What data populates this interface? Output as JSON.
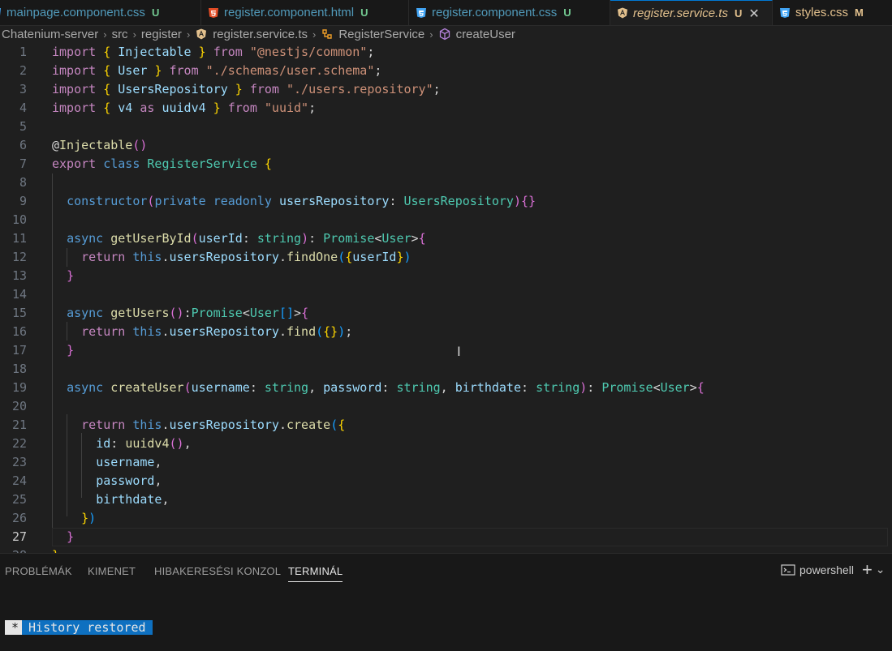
{
  "tabs": [
    {
      "label": "mainpage.component.css",
      "status": "U",
      "icon": "css-icon"
    },
    {
      "label": "register.component.html",
      "status": "U",
      "icon": "html-icon"
    },
    {
      "label": "register.component.css",
      "status": "U",
      "icon": "css-icon"
    },
    {
      "label": "register.service.ts",
      "status": "U",
      "icon": "angular-icon",
      "close": "✕"
    },
    {
      "label": "styles.css",
      "status": "M",
      "icon": "css-icon"
    }
  ],
  "breadcrumb": {
    "items": [
      "Chatenium-server",
      "src",
      "register",
      "register.service.ts",
      "RegisterService",
      "createUser"
    ],
    "separator": "›"
  },
  "editor": {
    "language": "typescript",
    "current_line": 27,
    "lines": [
      [
        [
          "import",
          "k"
        ],
        [
          " ",
          "p"
        ],
        [
          "{",
          "y"
        ],
        [
          " ",
          "p"
        ],
        [
          "Injectable",
          "v"
        ],
        [
          " ",
          "p"
        ],
        [
          "}",
          "y"
        ],
        [
          " ",
          "p"
        ],
        [
          "from",
          "k"
        ],
        [
          " ",
          "p"
        ],
        [
          "\"@nestjs/common\"",
          "s"
        ],
        [
          ";",
          "p"
        ]
      ],
      [
        [
          "import",
          "k"
        ],
        [
          " ",
          "p"
        ],
        [
          "{",
          "y"
        ],
        [
          " ",
          "p"
        ],
        [
          "User",
          "v"
        ],
        [
          " ",
          "p"
        ],
        [
          "}",
          "y"
        ],
        [
          " ",
          "p"
        ],
        [
          "from",
          "k"
        ],
        [
          " ",
          "p"
        ],
        [
          "\"./schemas/user.schema\"",
          "s"
        ],
        [
          ";",
          "p"
        ]
      ],
      [
        [
          "import",
          "k"
        ],
        [
          " ",
          "p"
        ],
        [
          "{",
          "y"
        ],
        [
          " ",
          "p"
        ],
        [
          "UsersRepository",
          "v"
        ],
        [
          " ",
          "p"
        ],
        [
          "}",
          "y"
        ],
        [
          " ",
          "p"
        ],
        [
          "from",
          "k"
        ],
        [
          " ",
          "p"
        ],
        [
          "\"./users.repository\"",
          "s"
        ],
        [
          ";",
          "p"
        ]
      ],
      [
        [
          "import",
          "k"
        ],
        [
          " ",
          "p"
        ],
        [
          "{",
          "y"
        ],
        [
          " ",
          "p"
        ],
        [
          "v4",
          "v"
        ],
        [
          " ",
          "p"
        ],
        [
          "as",
          "k"
        ],
        [
          " ",
          "p"
        ],
        [
          "uuidv4",
          "v"
        ],
        [
          " ",
          "p"
        ],
        [
          "}",
          "y"
        ],
        [
          " ",
          "p"
        ],
        [
          "from",
          "k"
        ],
        [
          " ",
          "p"
        ],
        [
          "\"uuid\"",
          "s"
        ],
        [
          ";",
          "p"
        ]
      ],
      [],
      [
        [
          "@",
          "p"
        ],
        [
          "Injectable",
          "f"
        ],
        [
          "(",
          "m"
        ],
        [
          ")",
          "m"
        ]
      ],
      [
        [
          "export",
          "k"
        ],
        [
          " ",
          "p"
        ],
        [
          "class",
          "b"
        ],
        [
          " ",
          "p"
        ],
        [
          "RegisterService",
          "t"
        ],
        [
          " ",
          "p"
        ],
        [
          "{",
          "y"
        ]
      ],
      [],
      [
        [
          "  ",
          "p"
        ],
        [
          "constructor",
          "b"
        ],
        [
          "(",
          "m"
        ],
        [
          "private",
          "b"
        ],
        [
          " ",
          "p"
        ],
        [
          "readonly",
          "b"
        ],
        [
          " ",
          "p"
        ],
        [
          "usersRepository",
          "v"
        ],
        [
          ":",
          "p"
        ],
        [
          " ",
          "p"
        ],
        [
          "UsersRepository",
          "t"
        ],
        [
          ")",
          "m"
        ],
        [
          "{}",
          "m"
        ]
      ],
      [],
      [
        [
          "  ",
          "p"
        ],
        [
          "async",
          "b"
        ],
        [
          " ",
          "p"
        ],
        [
          "getUserById",
          "f"
        ],
        [
          "(",
          "m"
        ],
        [
          "userId",
          "v"
        ],
        [
          ":",
          "p"
        ],
        [
          " ",
          "p"
        ],
        [
          "string",
          "t"
        ],
        [
          ")",
          "m"
        ],
        [
          ":",
          "p"
        ],
        [
          " ",
          "p"
        ],
        [
          "Promise",
          "t"
        ],
        [
          "<",
          "p"
        ],
        [
          "User",
          "t"
        ],
        [
          ">",
          "p"
        ],
        [
          "{",
          "m"
        ]
      ],
      [
        [
          "    ",
          "p"
        ],
        [
          "return",
          "k"
        ],
        [
          " ",
          "p"
        ],
        [
          "this",
          "b"
        ],
        [
          ".",
          "p"
        ],
        [
          "usersRepository",
          "v"
        ],
        [
          ".",
          "p"
        ],
        [
          "findOne",
          "f"
        ],
        [
          "(",
          "c"
        ],
        [
          "{",
          "y"
        ],
        [
          "userId",
          "v"
        ],
        [
          "}",
          "y"
        ],
        [
          ")",
          "c"
        ]
      ],
      [
        [
          "  ",
          "p"
        ],
        [
          "}",
          "m"
        ]
      ],
      [],
      [
        [
          "  ",
          "p"
        ],
        [
          "async",
          "b"
        ],
        [
          " ",
          "p"
        ],
        [
          "getUsers",
          "f"
        ],
        [
          "(",
          "m"
        ],
        [
          ")",
          "m"
        ],
        [
          ":",
          "p"
        ],
        [
          "Promise",
          "t"
        ],
        [
          "<",
          "p"
        ],
        [
          "User",
          "t"
        ],
        [
          "[]",
          "c"
        ],
        [
          ">",
          "p"
        ],
        [
          "{",
          "m"
        ]
      ],
      [
        [
          "    ",
          "p"
        ],
        [
          "return",
          "k"
        ],
        [
          " ",
          "p"
        ],
        [
          "this",
          "b"
        ],
        [
          ".",
          "p"
        ],
        [
          "usersRepository",
          "v"
        ],
        [
          ".",
          "p"
        ],
        [
          "find",
          "f"
        ],
        [
          "(",
          "c"
        ],
        [
          "{}",
          "y"
        ],
        [
          ")",
          "c"
        ],
        [
          ";",
          "p"
        ]
      ],
      [
        [
          "  ",
          "p"
        ],
        [
          "}",
          "m"
        ]
      ],
      [],
      [
        [
          "  ",
          "p"
        ],
        [
          "async",
          "b"
        ],
        [
          " ",
          "p"
        ],
        [
          "createUser",
          "f"
        ],
        [
          "(",
          "m"
        ],
        [
          "username",
          "v"
        ],
        [
          ":",
          "p"
        ],
        [
          " ",
          "p"
        ],
        [
          "string",
          "t"
        ],
        [
          ",",
          "p"
        ],
        [
          " ",
          "p"
        ],
        [
          "password",
          "v"
        ],
        [
          ":",
          "p"
        ],
        [
          " ",
          "p"
        ],
        [
          "string",
          "t"
        ],
        [
          ",",
          "p"
        ],
        [
          " ",
          "p"
        ],
        [
          "birthdate",
          "v"
        ],
        [
          ":",
          "p"
        ],
        [
          " ",
          "p"
        ],
        [
          "string",
          "t"
        ],
        [
          ")",
          "m"
        ],
        [
          ":",
          "p"
        ],
        [
          " ",
          "p"
        ],
        [
          "Promise",
          "t"
        ],
        [
          "<",
          "p"
        ],
        [
          "User",
          "t"
        ],
        [
          ">",
          "p"
        ],
        [
          "{",
          "m"
        ]
      ],
      [],
      [
        [
          "    ",
          "p"
        ],
        [
          "return",
          "k"
        ],
        [
          " ",
          "p"
        ],
        [
          "this",
          "b"
        ],
        [
          ".",
          "p"
        ],
        [
          "usersRepository",
          "v"
        ],
        [
          ".",
          "p"
        ],
        [
          "create",
          "f"
        ],
        [
          "(",
          "c"
        ],
        [
          "{",
          "y"
        ]
      ],
      [
        [
          "      ",
          "p"
        ],
        [
          "id",
          "v"
        ],
        [
          ":",
          "p"
        ],
        [
          " ",
          "p"
        ],
        [
          "uuidv4",
          "f"
        ],
        [
          "(",
          "m"
        ],
        [
          ")",
          "m"
        ],
        [
          ",",
          "p"
        ]
      ],
      [
        [
          "      ",
          "p"
        ],
        [
          "username",
          "v"
        ],
        [
          ",",
          "p"
        ]
      ],
      [
        [
          "      ",
          "p"
        ],
        [
          "password",
          "v"
        ],
        [
          ",",
          "p"
        ]
      ],
      [
        [
          "      ",
          "p"
        ],
        [
          "birthdate",
          "v"
        ],
        [
          ",",
          "p"
        ]
      ],
      [
        [
          "    ",
          "p"
        ],
        [
          "}",
          "y"
        ],
        [
          ")",
          "c"
        ]
      ],
      [
        [
          "  ",
          "p"
        ],
        [
          "}",
          "m"
        ]
      ],
      [
        [
          "}",
          "y"
        ]
      ]
    ]
  },
  "panel": {
    "tabs": [
      "PROBLÉMÁK",
      "KIMENET",
      "HIBAKERESÉSI KONZOL",
      "TERMINÁL"
    ],
    "active_tab": "TERMINÁL",
    "shell_label": "powershell",
    "add_label": "+",
    "dropdown_label": "⌄",
    "terminal": {
      "prefix": "*",
      "message": "History restored"
    }
  },
  "colors": {
    "accent": "#0078d4",
    "css": "#42a5f5",
    "html": "#e44d26",
    "angular": "#e2c08d",
    "untracked": "#73c991",
    "modified": "#e2c08d"
  }
}
